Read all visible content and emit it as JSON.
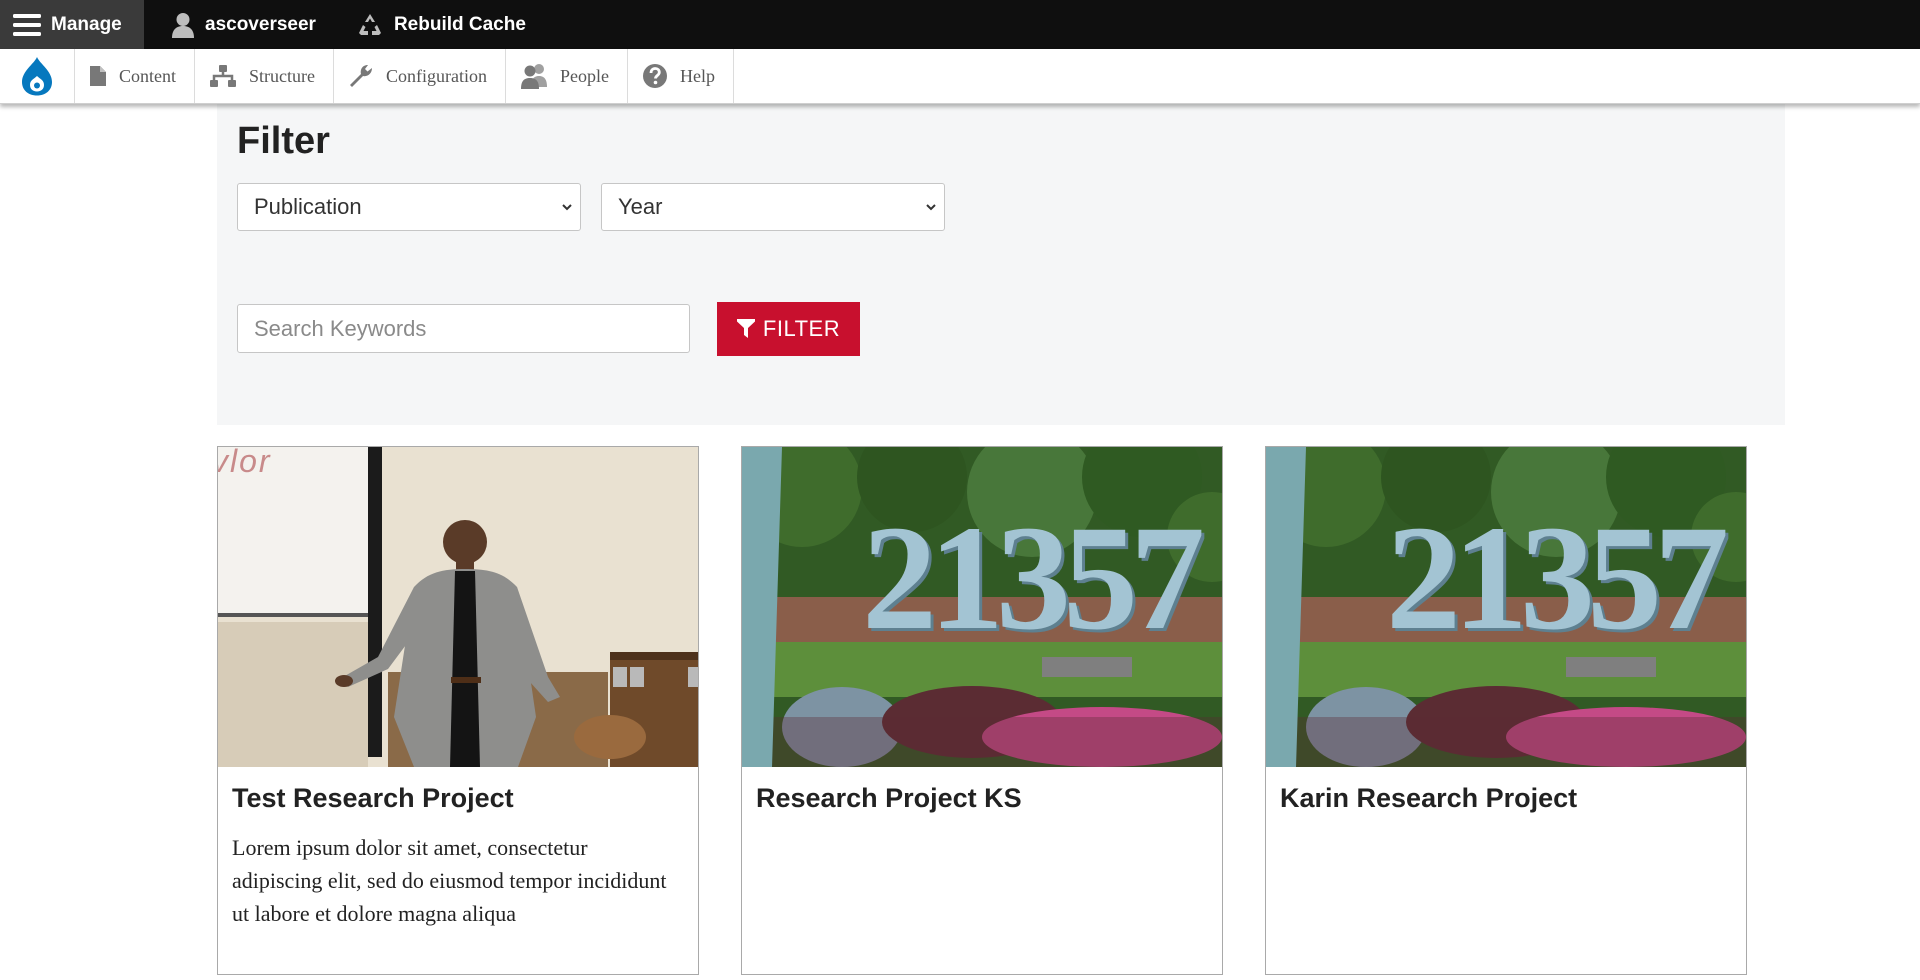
{
  "toolbar": {
    "manage_label": "Manage",
    "user_label": "ascoverseer",
    "rebuild_label": "Rebuild Cache"
  },
  "tray": {
    "items": [
      {
        "label": "Content",
        "icon": "file-icon"
      },
      {
        "label": "Structure",
        "icon": "sitemap-icon"
      },
      {
        "label": "Configuration",
        "icon": "wrench-icon"
      },
      {
        "label": "People",
        "icon": "people-icon"
      },
      {
        "label": "Help",
        "icon": "help-icon"
      }
    ]
  },
  "filter": {
    "title": "Filter",
    "publication_select": "Publication",
    "year_select": "Year",
    "search_placeholder": "Search Keywords",
    "button_label": "FILTER"
  },
  "cards": [
    {
      "title": "Test Research Project",
      "body": "Lorem ipsum dolor sit amet, consectetur adipiscing elit, sed do eiusmod tempor incididunt ut labore et dolore magna aliqua",
      "image_caption": "vlor"
    },
    {
      "title": "Research Project KS",
      "body": "",
      "image_caption": "21357"
    },
    {
      "title": "Karin Research Project",
      "body": "",
      "image_caption": "21357"
    }
  ],
  "colors": {
    "toolbar_bg": "#0f0f0f",
    "manage_bg": "#3a3a3a",
    "panel_bg": "#f5f6f7",
    "accent": "#c8102e",
    "drupal_blue": "#0678be"
  }
}
